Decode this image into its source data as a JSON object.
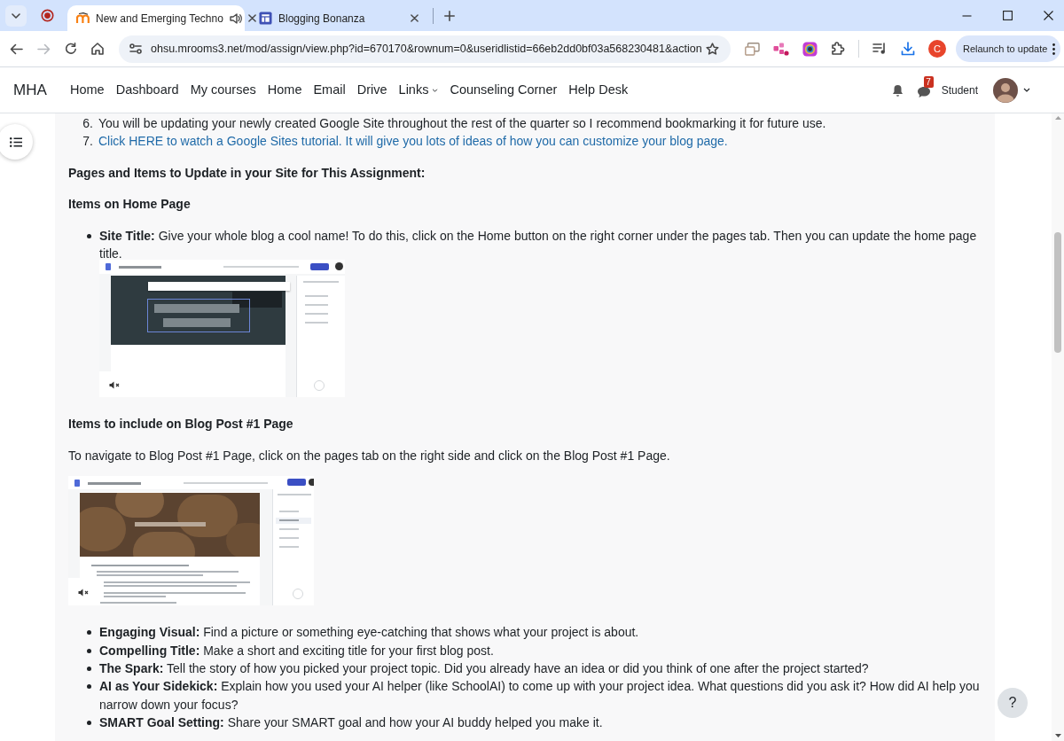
{
  "browser": {
    "tabs": [
      {
        "title": "New and Emerging Techno",
        "kind": "course",
        "selected": true,
        "audio_playing": true
      },
      {
        "title": "Blogging Bonanza",
        "kind": "site",
        "selected": false,
        "audio_playing": false
      }
    ],
    "forward_enabled": false,
    "url": "ohsu.mrooms3.net/mod/assign/view.php?id=670170&rownum=0&useridlistid=66eb2dd0bf03a568230481&action",
    "profile_initial": "C",
    "relaunch_label": "Relaunch to update"
  },
  "navbar": {
    "brand": "MHA",
    "items": [
      {
        "label": "Home",
        "dropdown": false
      },
      {
        "label": "Dashboard",
        "dropdown": false
      },
      {
        "label": "My courses",
        "dropdown": false
      },
      {
        "label": "Home",
        "dropdown": false
      },
      {
        "label": "Email",
        "dropdown": false
      },
      {
        "label": "Drive",
        "dropdown": false
      },
      {
        "label": "Links",
        "dropdown": true
      },
      {
        "label": "Counseling Corner",
        "dropdown": false
      },
      {
        "label": "Help Desk",
        "dropdown": false
      }
    ],
    "message_count": "7",
    "user_name": "Student"
  },
  "content": {
    "blocks": [
      {
        "kind": "numbered",
        "number": "6.",
        "text": "You will be updating your newly created Google Site throughout the rest of the quarter so I recommend bookmarking it for future use.",
        "link": false
      },
      {
        "kind": "numbered",
        "number": "7.",
        "text": "Click HERE to watch a Google Sites tutorial. It will give you lots of ideas of how you can customize your blog page.",
        "link": true
      },
      {
        "kind": "heading",
        "text": "Pages and Items to Update in your Site for This Assignment:"
      },
      {
        "kind": "heading",
        "text": "Items on Home Page"
      },
      {
        "kind": "bullets",
        "items": [
          {
            "text": "**Site Title:** Give your whole blog a cool name! To do this, click on the Home button on the right corner under the pages tab. Then you can update the home page title.",
            "video": {
              "kind": "home-page",
              "muted": true
            }
          }
        ]
      },
      {
        "kind": "heading",
        "text": "Items to include on Blog Post #1 Page"
      },
      {
        "kind": "paragraph",
        "text": "To navigate to Blog Post #1 Page, click on the pages tab on the right side and click on the Blog Post #1 Page."
      },
      {
        "kind": "video",
        "video": {
          "kind": "blog-post-page",
          "muted": true
        }
      },
      {
        "kind": "bullets",
        "items": [
          {
            "text": "**Engaging Visual:** Find a picture or something eye-catching that shows what your project is about."
          },
          {
            "text": "**Compelling Title:** Make a short and exciting title for your first blog post."
          },
          {
            "text": "**The Spark:** Tell the story of how you picked your project topic. Did you already have an idea or did you think of one after the project started?"
          },
          {
            "text": "**AI as Your Sidekick:** Explain how you used your AI helper (like SchoolAI) to come up with your project idea. What questions did you ask it? How did AI help you narrow down your focus?"
          },
          {
            "text": "**SMART Goal Setting:** Share your SMART goal and how your AI buddy helped you make it."
          }
        ]
      }
    ]
  },
  "help_button": "?"
}
